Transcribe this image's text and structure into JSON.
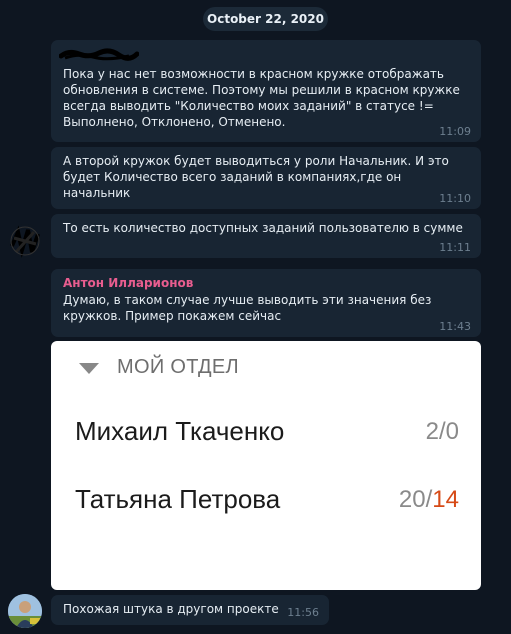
{
  "date_pill": "October 22, 2020",
  "messages": [
    {
      "text": "Пока у нас нет возможности в красном кружке отображать обновления в системе. Поэтому мы решили в красном кружке всегда выводить \"Количество моих заданий\" в статусе != Выполнено, Отклонено, Отменено.",
      "time": "11:09"
    },
    {
      "text": "А второй кружок будет выводиться у роли Начальник. И это будет Количество всего заданий в компаниях,где он начальник",
      "time": "11:10"
    },
    {
      "text": "То есть количество доступных заданий пользователю в сумме",
      "time": "11:11"
    },
    {
      "sender": "Антон Илларионов",
      "text": "Думаю, в таком случае лучше выводить эти значения без кружков. Пример покажем сейчас",
      "time": "11:43"
    },
    {
      "text": "Похожая штука в другом проекте",
      "time": "11:56"
    }
  ],
  "card": {
    "title": "МОЙ ОТДЕЛ",
    "rows": [
      {
        "name": "Михаил Ткаченко",
        "count_a": "2/0",
        "count_b": ""
      },
      {
        "name": "Татьяна Петрова",
        "count_a": "20/",
        "count_b": "14"
      }
    ]
  },
  "colors": {
    "background": "#0e1621",
    "bubble": "#182533",
    "sender_name": "#e85d8f",
    "count_highlight": "#d64a16"
  }
}
